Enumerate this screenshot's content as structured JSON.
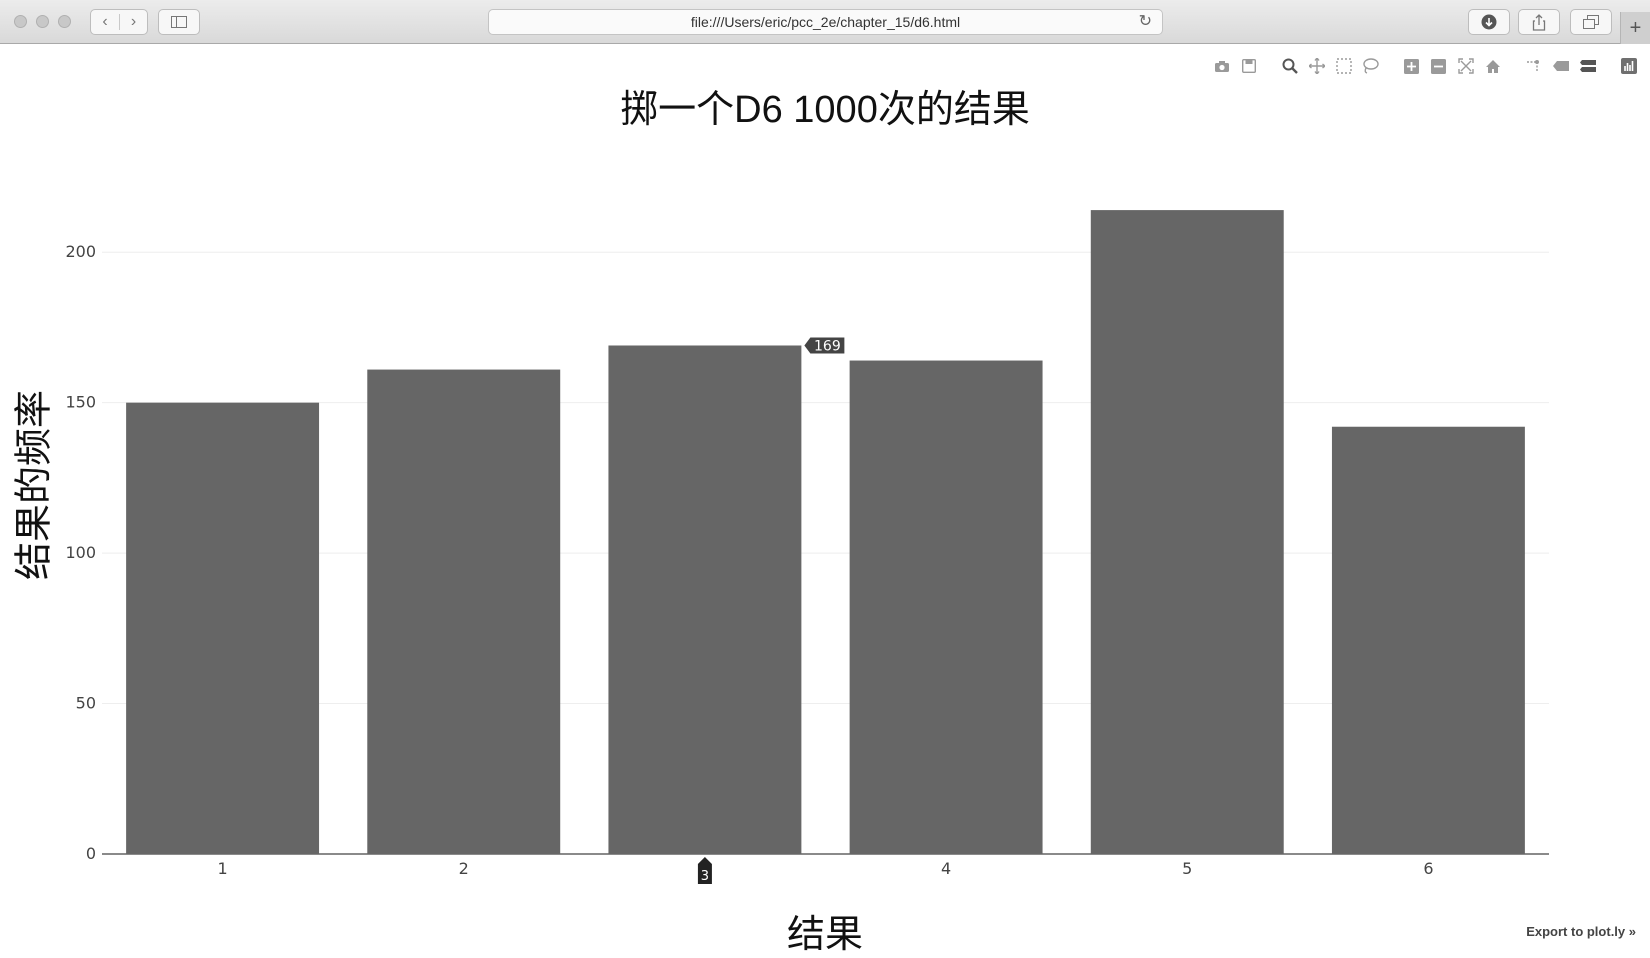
{
  "browser": {
    "url": "file:///Users/eric/pcc_2e/chapter_15/d6.html"
  },
  "modebar": {
    "icons": [
      "camera-icon",
      "save-icon",
      "zoom-icon",
      "pan-icon",
      "box-select-icon",
      "lasso-icon",
      "zoom-in-icon",
      "zoom-out-icon",
      "autoscale-icon",
      "home-icon",
      "spike-lines-icon",
      "hover-closest-icon",
      "hover-compare-icon",
      "plotly-logo-icon"
    ]
  },
  "chart_data": {
    "type": "bar",
    "title": "掷一个D6 1000次的结果",
    "xlabel": "结果",
    "ylabel": "结果的频率",
    "categories": [
      "1",
      "2",
      "3",
      "4",
      "5",
      "6"
    ],
    "values": [
      150,
      161,
      169,
      164,
      214,
      142
    ],
    "ylim": [
      0,
      224
    ],
    "yticks": [
      0,
      50,
      100,
      150,
      200
    ],
    "bar_color": "#666666",
    "grid": true,
    "hover": {
      "category": "3",
      "value_label": "169",
      "category_label": "3"
    }
  },
  "footer": {
    "export_link": "Export to plot.ly »"
  }
}
